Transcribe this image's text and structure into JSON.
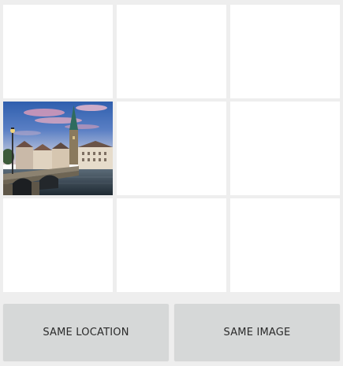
{
  "grid": {
    "cells": [
      {
        "has_image": false
      },
      {
        "has_image": false
      },
      {
        "has_image": false
      },
      {
        "has_image": true,
        "image": "city-bridge-church-photo"
      },
      {
        "has_image": false
      },
      {
        "has_image": false
      },
      {
        "has_image": false
      },
      {
        "has_image": false
      },
      {
        "has_image": false
      }
    ]
  },
  "actions": {
    "same_location_label": "SAME LOCATION",
    "same_image_label": "SAME IMAGE"
  },
  "colors": {
    "background": "#eeeeee",
    "cell": "#ffffff",
    "button": "#d6d8d8",
    "button_text": "#2a2a2a"
  }
}
